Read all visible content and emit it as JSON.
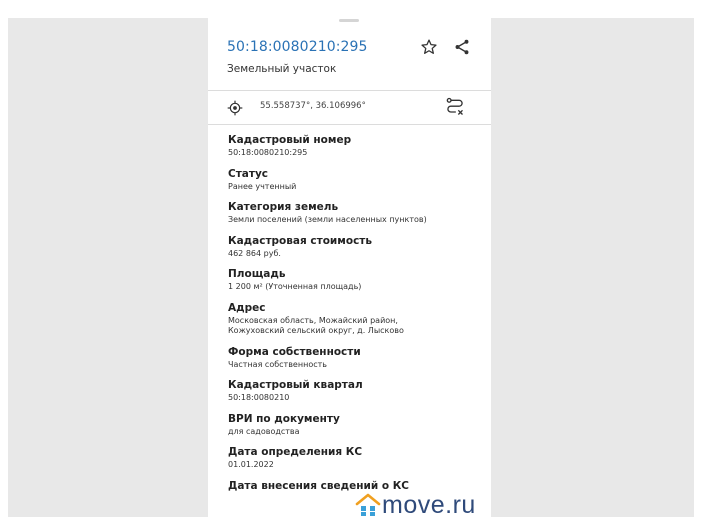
{
  "header": {
    "cadastral_number": "50:18:0080210:295",
    "object_type": "Земельный участок",
    "icons": {
      "favorite": "star-outline-icon",
      "share": "share-icon"
    }
  },
  "location": {
    "coordinates": "55.558737°, 36.106996°",
    "icons": {
      "locate": "target-icon",
      "route": "route-icon"
    }
  },
  "fields": [
    {
      "label": "Кадастровый номер",
      "value": "50:18:0080210:295"
    },
    {
      "label": "Статус",
      "value": "Ранее учтенный"
    },
    {
      "label": "Категория земель",
      "value": "Земли поселений (земли населенных пунктов)"
    },
    {
      "label": "Кадастровая стоимость",
      "value": "462 864 руб."
    },
    {
      "label": "Площадь",
      "value": "1 200 м² (Уточненная площадь)"
    },
    {
      "label": "Адрес",
      "value_lines": [
        "Московская область, Можайский район,",
        "Кожуховский сельский округ, д. Лысково"
      ]
    },
    {
      "label": "Форма собственности",
      "value": "Частная собственность"
    },
    {
      "label": "Кадастровый квартал",
      "value": "50:18:0080210"
    },
    {
      "label": "ВРИ по документу",
      "value": "для садоводства"
    },
    {
      "label": "Дата определения КС",
      "value": "01.01.2022"
    },
    {
      "label": "Дата внесения сведений о КС"
    }
  ],
  "watermark": {
    "brand": "move.ru",
    "colors": {
      "text": "#2f4a7a",
      "roof": "#f0a020",
      "house": "#3aa0d8"
    }
  },
  "colors": {
    "accent": "#2a72b5",
    "background": "#e8e8e8",
    "panel": "#ffffff"
  }
}
